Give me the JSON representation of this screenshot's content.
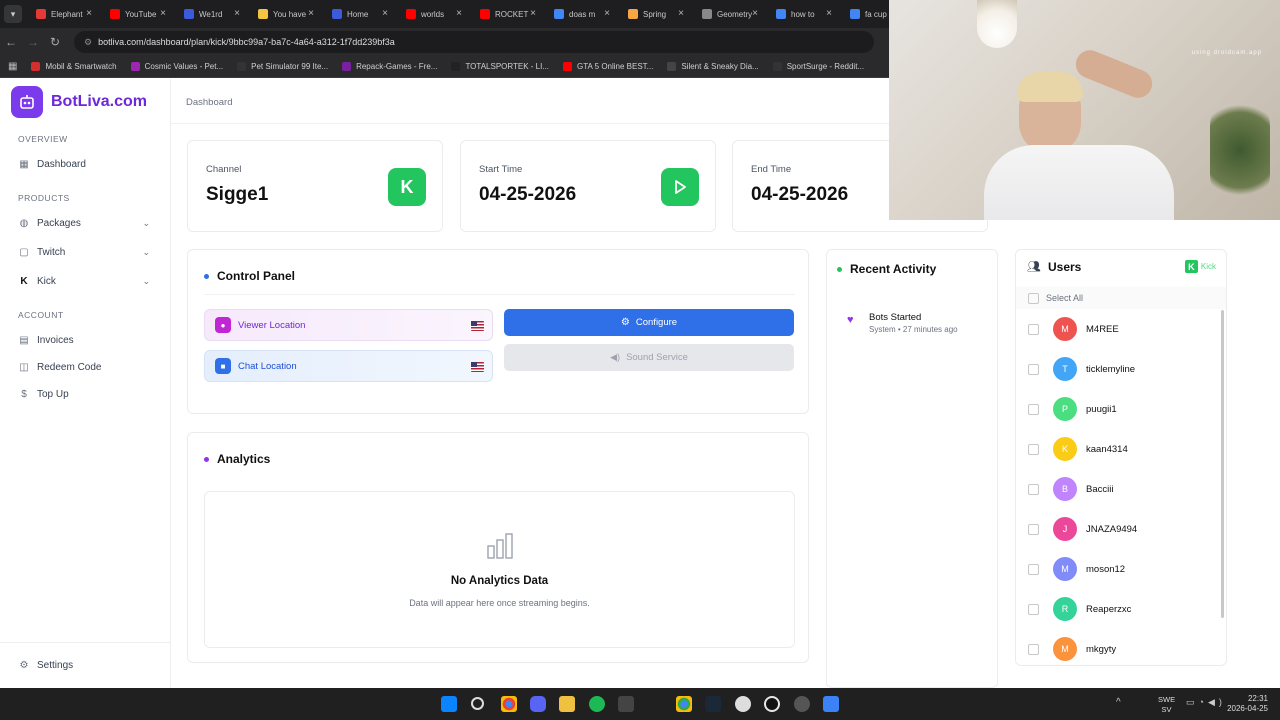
{
  "browser": {
    "tabs": [
      {
        "title": "Elephant",
        "color": "#e53935"
      },
      {
        "title": "YouTube",
        "color": "#ff0000"
      },
      {
        "title": "We1rd",
        "color": "#3b5bdb"
      },
      {
        "title": "You have",
        "color": "#f4c542"
      },
      {
        "title": "Home",
        "color": "#3b5bdb"
      },
      {
        "title": "worlds",
        "color": "#ff0000"
      },
      {
        "title": "ROCKET",
        "color": "#ff0000"
      },
      {
        "title": "doas m",
        "color": "#4285f4"
      },
      {
        "title": "Spring",
        "color": "#f4a742"
      },
      {
        "title": "Geometry",
        "color": "#888888"
      },
      {
        "title": "how to",
        "color": "#4285f4"
      },
      {
        "title": "fa cup",
        "color": "#4285f4"
      }
    ],
    "url": "botliva.com/dashboard/plan/kick/9bbc99a7-ba7c-4a64-a312-1f7dd239bf3a",
    "bookmarks": [
      {
        "label": "Mobil & Smartwatch",
        "color": "#d32f2f"
      },
      {
        "label": "Cosmic Values - Pet...",
        "color": "#9c27b0"
      },
      {
        "label": "Pet Simulator 99 Ite...",
        "color": "#333333"
      },
      {
        "label": "Repack-Games - Fre...",
        "color": "#7b1fa2"
      },
      {
        "label": "TOTALSPORTEK - LI...",
        "color": "#222222"
      },
      {
        "label": "GTA 5 Online BEST...",
        "color": "#ff0000"
      },
      {
        "label": "Silent & Sneaky Dia...",
        "color": "#444444"
      },
      {
        "label": "SportSurge - Reddit...",
        "color": "#333333"
      }
    ]
  },
  "brand": {
    "name": "BotLiva.com",
    "accent": "#7c3aed"
  },
  "sidebar": {
    "overview_heading": "OVERVIEW",
    "dashboard": "Dashboard",
    "products_heading": "PRODUCTS",
    "packages": "Packages",
    "twitch": "Twitch",
    "kick": "Kick",
    "account_heading": "ACCOUNT",
    "invoices": "Invoices",
    "redeem": "Redeem Code",
    "topup": "Top Up",
    "settings": "Settings"
  },
  "breadcrumb": "Dashboard",
  "stats": [
    {
      "label": "Channel",
      "value": "Sigge1",
      "icon": "kick-logo-icon"
    },
    {
      "label": "Start Time",
      "value": "04-25-2026",
      "icon": "play-icon"
    },
    {
      "label": "End Time",
      "value": "04-25-2026",
      "icon": "stop-icon"
    }
  ],
  "control_panel": {
    "title": "Control Panel",
    "viewer_location": "Viewer Location",
    "chat_location": "Chat Location",
    "configure": "Configure",
    "sound_service": "Sound Service"
  },
  "analytics": {
    "title": "Analytics",
    "empty_title": "No Analytics Data",
    "empty_sub": "Data will appear here once streaming begins."
  },
  "recent": {
    "title": "Recent Activity",
    "items": [
      {
        "title": "Bots Started",
        "meta": "System • 27 minutes ago"
      }
    ]
  },
  "users": {
    "title": "Users",
    "platform": "Kick",
    "select_all": "Select All",
    "list": [
      {
        "initial": "M",
        "name": "M4REE",
        "color": "#ef5350"
      },
      {
        "initial": "T",
        "name": "ticklemyline",
        "color": "#42a5f5"
      },
      {
        "initial": "P",
        "name": "puugii1",
        "color": "#4ade80"
      },
      {
        "initial": "K",
        "name": "kaan4314",
        "color": "#facc15"
      },
      {
        "initial": "B",
        "name": "Bacciii",
        "color": "#c084fc"
      },
      {
        "initial": "J",
        "name": "JNAZA9494",
        "color": "#ec4899"
      },
      {
        "initial": "M",
        "name": "moson12",
        "color": "#818cf8"
      },
      {
        "initial": "R",
        "name": "Reaperzxc",
        "color": "#34d399"
      },
      {
        "initial": "M",
        "name": "mkgyty",
        "color": "#fb923c"
      }
    ]
  },
  "webcam": {
    "overlay_text": "using droidcam.app"
  },
  "taskbar": {
    "lang": "SWE",
    "lang2": "SV",
    "time": "22:31",
    "date": "2026-04-25"
  }
}
